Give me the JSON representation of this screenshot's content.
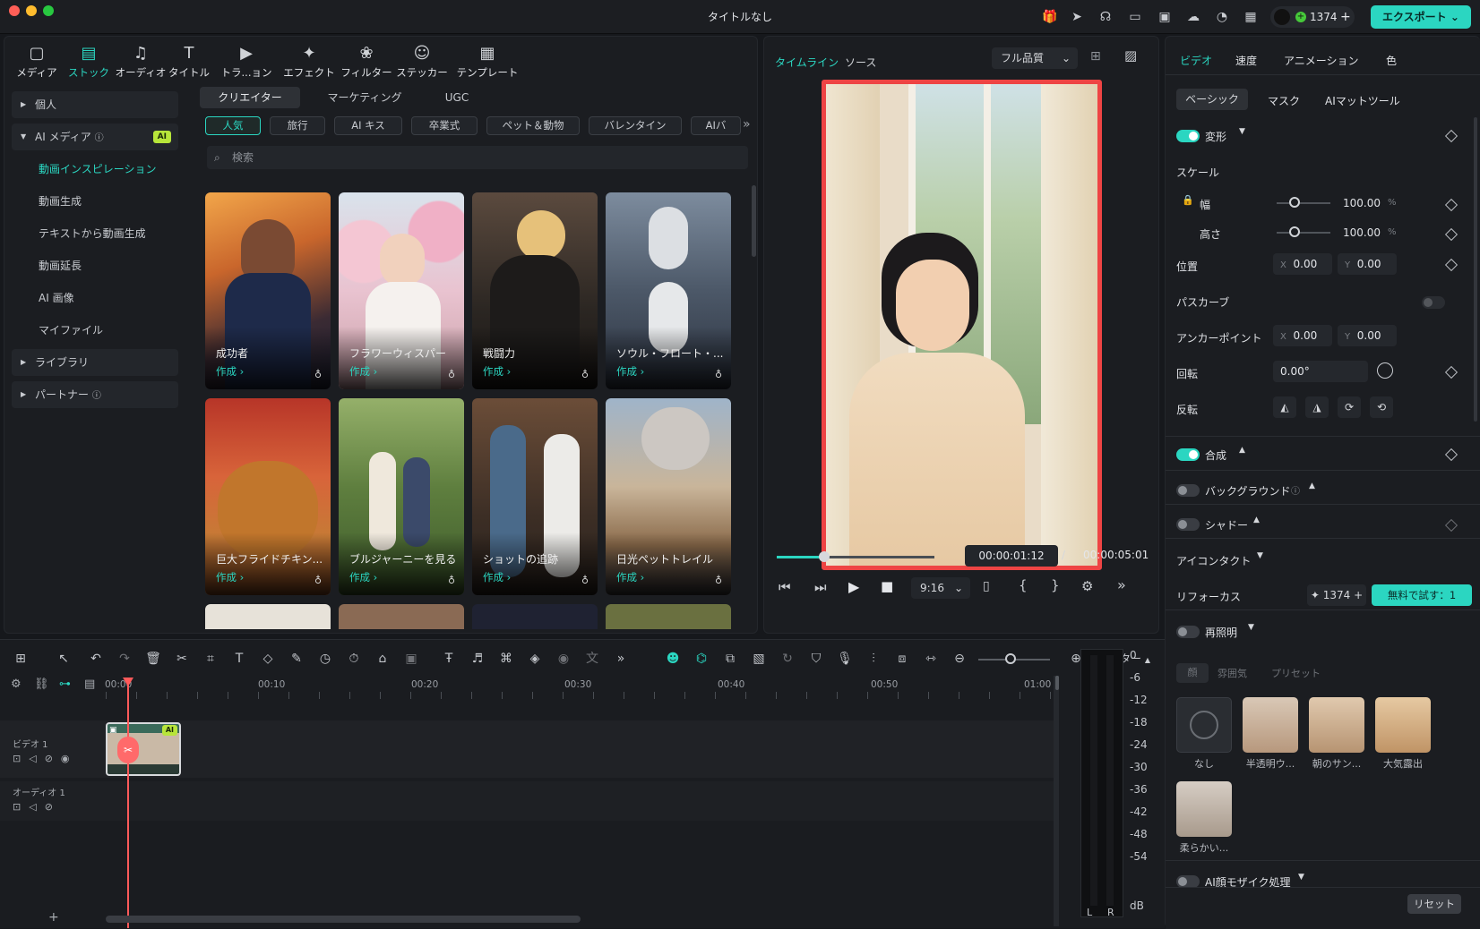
{
  "app": {
    "title": "タイトルなし",
    "credits": "1374",
    "export_label": "エクスポート"
  },
  "categories": [
    {
      "label": "メディア",
      "icon": "media-icon"
    },
    {
      "label": "ストック",
      "icon": "stock-icon"
    },
    {
      "label": "オーディオ",
      "icon": "audio-icon"
    },
    {
      "label": "タイトル",
      "icon": "title-icon"
    },
    {
      "label": "トラ...ョン",
      "icon": "transition-icon"
    },
    {
      "label": "エフェクト",
      "icon": "effect-icon"
    },
    {
      "label": "フィルター",
      "icon": "filter-icon"
    },
    {
      "label": "ステッカー",
      "icon": "sticker-icon"
    },
    {
      "label": "テンプレート",
      "icon": "template-icon"
    }
  ],
  "sidebar": {
    "personal": "個人",
    "ai_media": "AI メディア",
    "ai_badge": "AI",
    "ai_items": [
      "動画インスピレーション",
      "動画生成",
      "テキストから動画生成",
      "動画延長",
      "AI 画像",
      "マイファイル"
    ],
    "library": "ライブラリ",
    "partner": "パートナー"
  },
  "filter_tabs": [
    "クリエイター",
    "マーケティング",
    "UGC"
  ],
  "chips": [
    "人気",
    "旅行",
    "AI キス",
    "卒業式",
    "ペット＆動物",
    "バレンタイン",
    "AIバ"
  ],
  "search": {
    "placeholder": "検索"
  },
  "cards": [
    {
      "name": "成功者",
      "action": "作成 ›"
    },
    {
      "name": "フラワーウィスパー",
      "action": "作成 ›"
    },
    {
      "name": "戦闘力",
      "action": "作成 ›"
    },
    {
      "name": "ソウル・フロート・...",
      "action": "作成 ›"
    },
    {
      "name": "巨大フライドチキン...",
      "action": "作成 ›"
    },
    {
      "name": "ブルジャーニーを見る",
      "action": "作成 ›"
    },
    {
      "name": "ショットの追跡",
      "action": "作成 ›"
    },
    {
      "name": "日光ペットトレイル",
      "action": "作成 ›"
    }
  ],
  "preview": {
    "tab_timeline": "タイムライン",
    "tab_source": "ソース",
    "quality": "フル品質",
    "current_time": "00:00:01:12",
    "separator": "/",
    "total_time": "00:00:05:01",
    "aspect": "9:16",
    "progress": 0.3
  },
  "properties": {
    "tabs": [
      "ビデオ",
      "速度",
      "アニメーション",
      "色"
    ],
    "subtabs": [
      "ベーシック",
      "マスク",
      "AIマットツール"
    ],
    "transform": "変形",
    "scale": "スケール",
    "width": "幅",
    "height": "高さ",
    "width_value": "100.00",
    "height_value": "100.00",
    "percent": "%",
    "position": "位置",
    "x": "X",
    "y": "Y",
    "pos_x": "0.00",
    "pos_y": "0.00",
    "path_curve": "パスカーブ",
    "anchor": "アンカーポイント",
    "anchor_x": "0.00",
    "anchor_y": "0.00",
    "rotation": "回転",
    "rotation_value": "0.00°",
    "flip": "反転",
    "composite": "合成",
    "background": "バックグラウンド",
    "shadow": "シャドー",
    "eye_contact": "アイコンタクト",
    "refocus": "リフォーカス",
    "refocus_credits": "1374",
    "try_free": "無料で試す：1",
    "relight": "再照明",
    "relight_tabs": [
      "顔",
      "雰囲気",
      "プリセット"
    ],
    "presets": [
      "なし",
      "半透明ウ...",
      "朝のサン...",
      "大気露出",
      "柔らかい..."
    ],
    "mosaic": "AI顔モザイク処理",
    "reset": "リセット"
  },
  "timeline": {
    "ruler": [
      "00:00",
      "00:10",
      "00:20",
      "00:30",
      "00:40",
      "00:50",
      "01:00"
    ],
    "video_track": "ビデオ 1",
    "audio_track": "オーディオ 1",
    "clip_badge": "AI",
    "meter_label": "メーター",
    "db_scale": [
      "0",
      "-6",
      "-12",
      "-18",
      "-24",
      "-30",
      "-36",
      "-42",
      "-48",
      "-54",
      "dB"
    ],
    "channels": [
      "L",
      "R"
    ]
  },
  "colors": {
    "accent": "#2bd6c1",
    "playhead": "#ff5a5a",
    "frame": "#ee4444"
  }
}
